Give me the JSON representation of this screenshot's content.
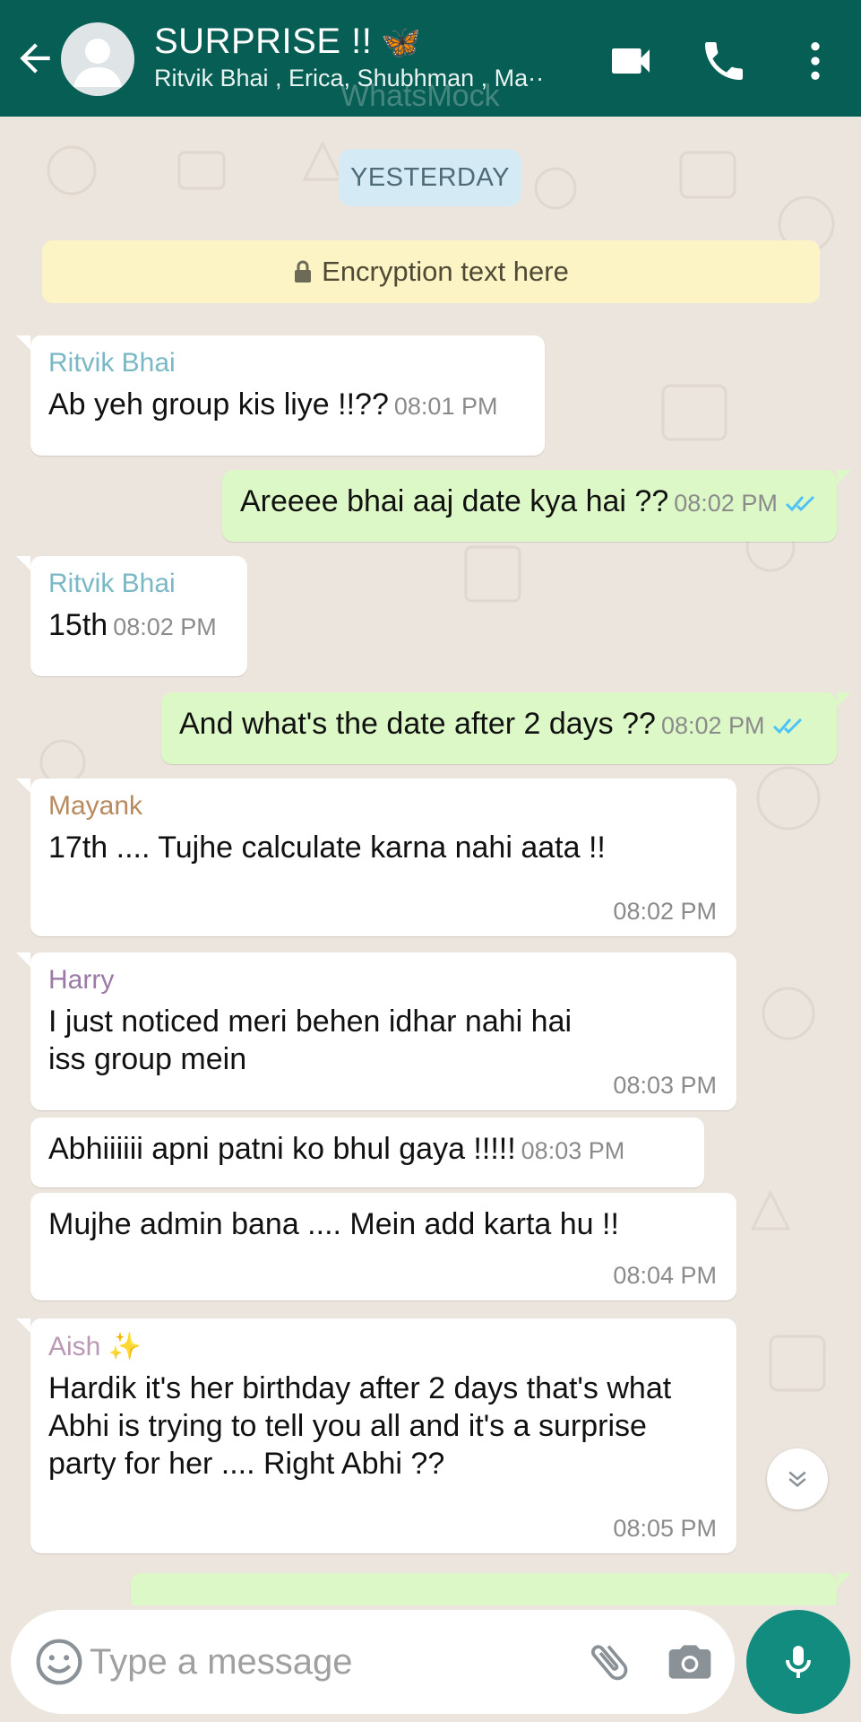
{
  "header": {
    "title": "SURPRISE !!",
    "title_emoji": "🦋",
    "subtitle": "Ritvik Bhai , Erica, Shubhman , Ma··",
    "watermark": "WhatsMock",
    "icons": [
      "back-arrow-icon",
      "avatar-icon",
      "video-call-icon",
      "phone-icon",
      "more-vert-icon"
    ],
    "color": "#075e54"
  },
  "chat": {
    "date_label": "YESTERDAY",
    "encryption_text": "Encryption text here",
    "messages": [
      {
        "direction": "in",
        "sender": "Ritvik Bhai",
        "sender_color": "#7ab8c6",
        "text": "Ab yeh group kis liye !!??",
        "time": "08:01 PM"
      },
      {
        "direction": "out",
        "text": "Areeee bhai aaj date kya hai ??",
        "time": "08:02 PM",
        "status": "read"
      },
      {
        "direction": "in",
        "sender": "Ritvik Bhai",
        "sender_color": "#7ab8c6",
        "text": "15th",
        "time": "08:02 PM"
      },
      {
        "direction": "out",
        "text": "And what's the date after 2 days ??",
        "time": "08:02 PM",
        "status": "read"
      },
      {
        "direction": "in",
        "sender": "Mayank",
        "sender_color": "#b88a5e",
        "text": "17th .... Tujhe calculate karna nahi aata !!",
        "time": "08:02 PM"
      },
      {
        "direction": "in",
        "sender": "Harry",
        "sender_color": "#9b7aa6",
        "text": "I just noticed meri behen idhar nahi hai iss group mein",
        "time": "08:03 PM"
      },
      {
        "direction": "in",
        "text": "Abhiiiiii apni patni ko bhul gaya !!!!!",
        "time": "08:03 PM"
      },
      {
        "direction": "in",
        "text": "Mujhe admin bana .... Mein add karta hu !!",
        "time": "08:04 PM"
      },
      {
        "direction": "in",
        "sender": "Aish ✨",
        "sender_color": "#b999b5",
        "text": "Hardik it's her birthday after 2 days that's what Abhi is trying to tell you all and it's a surprise party for her .... Right Abhi ??",
        "time": "08:05 PM"
      }
    ],
    "colors": {
      "incoming": "#ffffff",
      "outgoing": "#dcf8c6",
      "read_ticks": "#4fc3f7"
    }
  },
  "input": {
    "placeholder": "Type a message",
    "icons": [
      "emoji-icon",
      "attach-icon",
      "camera-icon",
      "mic-icon"
    ]
  }
}
